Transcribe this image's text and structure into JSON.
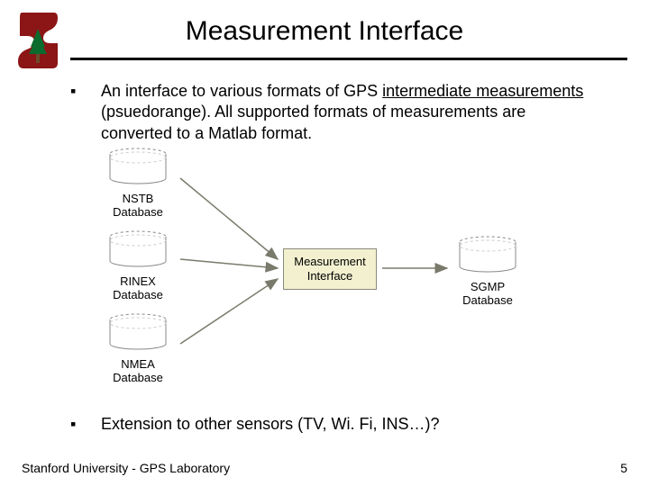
{
  "title": "Measurement Interface",
  "bullet1_a": "An interface to various formats of GPS ",
  "bullet1_b": "intermediate measurements",
  "bullet1_c": " (psuedorange).  All supported formats of measurements are converted to a Matlab format.",
  "bullet2": "Extension to other sensors (TV, Wi. Fi, INS…)?",
  "diagram": {
    "db_nstb_1": "NSTB",
    "db_nstb_2": "Database",
    "db_rinex_1": "RINEX",
    "db_rinex_2": "Database",
    "db_nmea_1": "NMEA",
    "db_nmea_2": "Database",
    "db_sgmp_1": "SGMP",
    "db_sgmp_2": "Database",
    "mi_1": "Measurement",
    "mi_2": "Interface"
  },
  "footer": "Stanford University - GPS Laboratory",
  "page": "5"
}
